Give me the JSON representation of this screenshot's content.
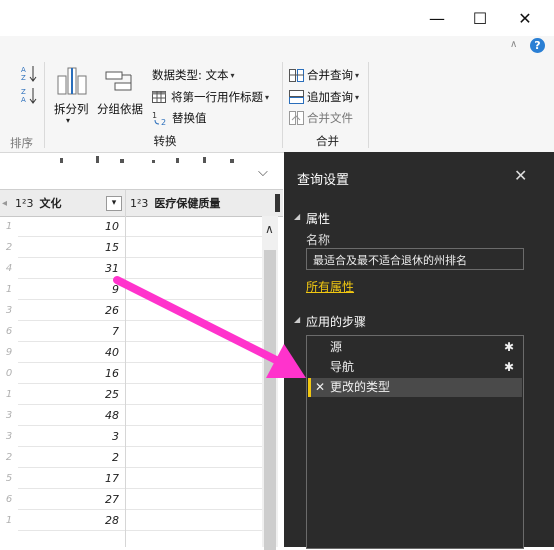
{
  "window": {
    "minimize_glyph": "—",
    "maximize_glyph": "☐",
    "close_glyph": "✕",
    "help_glyph": "?"
  },
  "ribbon": {
    "sort_group_label": "排序",
    "split_column_label": "拆分列",
    "group_by_label": "分组依据",
    "data_type_label": "数据类型: 文本",
    "first_row_header_label": "将第一行用作标题",
    "replace_values_label": "替换值",
    "transform_group_label": "转换",
    "merge_queries_label": "合并查询",
    "append_queries_label": "追加查询",
    "combine_files_label": "合并文件",
    "combine_group_label": "合并"
  },
  "grid": {
    "columns": [
      {
        "type_icon": "1²3",
        "name": "文化"
      },
      {
        "type_icon": "1²3",
        "name": "医疗保健质量"
      }
    ],
    "rows": [
      {
        "num": "1",
        "value": "10"
      },
      {
        "num": "2",
        "value": "15"
      },
      {
        "num": "4",
        "value": "31"
      },
      {
        "num": "1",
        "value": "9"
      },
      {
        "num": "3",
        "value": "26"
      },
      {
        "num": "6",
        "value": "7"
      },
      {
        "num": "9",
        "value": "40"
      },
      {
        "num": "0",
        "value": "16"
      },
      {
        "num": "1",
        "value": "25"
      },
      {
        "num": "3",
        "value": "48"
      },
      {
        "num": "3",
        "value": "3"
      },
      {
        "num": "2",
        "value": "2"
      },
      {
        "num": "5",
        "value": "17"
      },
      {
        "num": "6",
        "value": "27"
      },
      {
        "num": "1",
        "value": "28"
      }
    ]
  },
  "query_settings": {
    "title": "查询设置",
    "properties_title": "属性",
    "name_label": "名称",
    "name_value": "最适合及最不适合退休的州排名",
    "all_properties_link": "所有属性",
    "applied_steps_title": "应用的步骤",
    "steps": [
      {
        "label": "源",
        "has_gear": true,
        "selected": false
      },
      {
        "label": "导航",
        "has_gear": true,
        "selected": false
      },
      {
        "label": "更改的类型",
        "has_gear": false,
        "selected": true
      }
    ]
  },
  "colors": {
    "pane_bg": "#2b2b2b",
    "link": "#f2c811",
    "arrow": "#ff33cc",
    "selected_step": "#4a4a4a"
  }
}
